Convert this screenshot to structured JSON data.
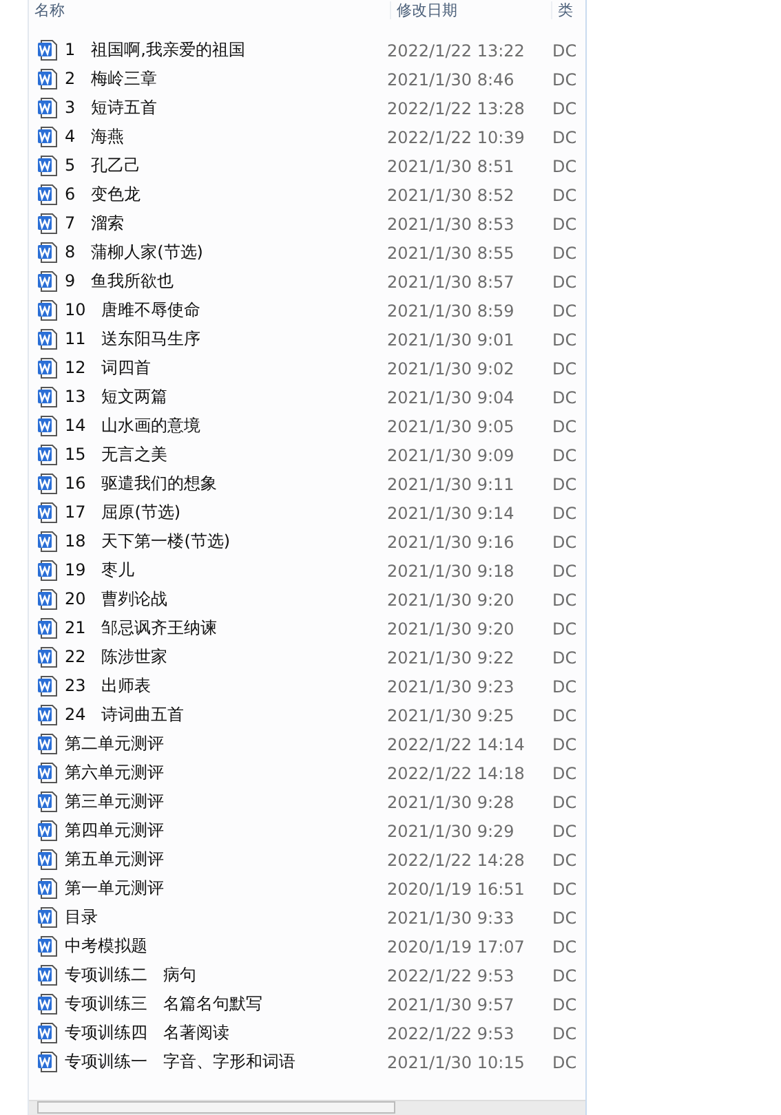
{
  "columns": [
    "名称",
    "修改日期",
    "类"
  ],
  "rows": [
    {
      "name": "1   祖国啊,我亲爱的祖国",
      "date": "2022/1/22 13:22",
      "type": "DC"
    },
    {
      "name": "2   梅岭三章",
      "date": "2021/1/30 8:46",
      "type": "DC"
    },
    {
      "name": "3   短诗五首",
      "date": "2022/1/22 13:28",
      "type": "DC"
    },
    {
      "name": "4   海燕",
      "date": "2022/1/22 10:39",
      "type": "DC"
    },
    {
      "name": "5   孔乙己",
      "date": "2021/1/30 8:51",
      "type": "DC"
    },
    {
      "name": "6   变色龙",
      "date": "2021/1/30 8:52",
      "type": "DC"
    },
    {
      "name": "7   溜索",
      "date": "2021/1/30 8:53",
      "type": "DC"
    },
    {
      "name": "8   蒲柳人家(节选)",
      "date": "2021/1/30 8:55",
      "type": "DC"
    },
    {
      "name": "9   鱼我所欲也",
      "date": "2021/1/30 8:57",
      "type": "DC"
    },
    {
      "name": "10   唐雎不辱使命",
      "date": "2021/1/30 8:59",
      "type": "DC"
    },
    {
      "name": "11   送东阳马生序",
      "date": "2021/1/30 9:01",
      "type": "DC"
    },
    {
      "name": "12   词四首",
      "date": "2021/1/30 9:02",
      "type": "DC"
    },
    {
      "name": "13   短文两篇",
      "date": "2021/1/30 9:04",
      "type": "DC"
    },
    {
      "name": "14   山水画的意境",
      "date": "2021/1/30 9:05",
      "type": "DC"
    },
    {
      "name": "15   无言之美",
      "date": "2021/1/30 9:09",
      "type": "DC"
    },
    {
      "name": "16   驱遣我们的想象",
      "date": "2021/1/30 9:11",
      "type": "DC"
    },
    {
      "name": "17   屈原(节选)",
      "date": "2021/1/30 9:14",
      "type": "DC"
    },
    {
      "name": "18   天下第一楼(节选)",
      "date": "2021/1/30 9:16",
      "type": "DC"
    },
    {
      "name": "19   枣儿",
      "date": "2021/1/30 9:18",
      "type": "DC"
    },
    {
      "name": "20   曹刿论战",
      "date": "2021/1/30 9:20",
      "type": "DC"
    },
    {
      "name": "21   邹忌讽齐王纳谏",
      "date": "2021/1/30 9:20",
      "type": "DC"
    },
    {
      "name": "22   陈涉世家",
      "date": "2021/1/30 9:22",
      "type": "DC"
    },
    {
      "name": "23   出师表",
      "date": "2021/1/30 9:23",
      "type": "DC"
    },
    {
      "name": "24   诗词曲五首",
      "date": "2021/1/30 9:25",
      "type": "DC"
    },
    {
      "name": "第二单元测评",
      "date": "2022/1/22 14:14",
      "type": "DC"
    },
    {
      "name": "第六单元测评",
      "date": "2022/1/22 14:18",
      "type": "DC"
    },
    {
      "name": "第三单元测评",
      "date": "2021/1/30 9:28",
      "type": "DC"
    },
    {
      "name": "第四单元测评",
      "date": "2021/1/30 9:29",
      "type": "DC"
    },
    {
      "name": "第五单元测评",
      "date": "2022/1/22 14:28",
      "type": "DC"
    },
    {
      "name": "第一单元测评",
      "date": "2020/1/19 16:51",
      "type": "DC"
    },
    {
      "name": "目录",
      "date": "2021/1/30 9:33",
      "type": "DC"
    },
    {
      "name": "中考模拟题",
      "date": "2020/1/19 17:07",
      "type": "DC"
    },
    {
      "name": "专项训练二   病句",
      "date": "2022/1/22 9:53",
      "type": "DC"
    },
    {
      "name": "专项训练三   名篇名句默写",
      "date": "2021/1/30 9:57",
      "type": "DC"
    },
    {
      "name": "专项训练四   名著阅读",
      "date": "2022/1/22 9:53",
      "type": "DC"
    },
    {
      "name": "专项训练一   字音、字形和词语",
      "date": "2021/1/30 10:15",
      "type": "DC"
    }
  ]
}
